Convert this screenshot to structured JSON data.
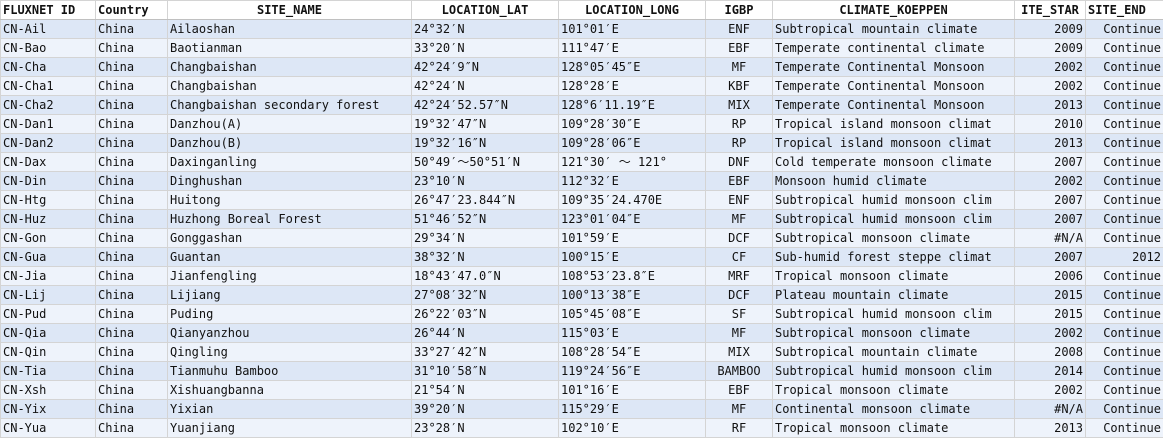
{
  "headers": [
    "FLUXNET ID",
    "Country",
    "SITE_NAME",
    "LOCATION_LAT",
    "LOCATION_LONG",
    "IGBP",
    "CLIMATE_KOEPPEN",
    "ITE_STAR",
    "SITE_END"
  ],
  "rows": [
    [
      "CN-Ail",
      "China",
      "Ailaoshan",
      "24°32′N",
      "101°01′E",
      "ENF",
      "Subtropical mountain climate",
      "2009",
      "Continue"
    ],
    [
      "CN-Bao",
      "China",
      "Baotianman",
      "33°20′N",
      "111°47′E",
      "EBF",
      "Temperate continental climate",
      "2009",
      "Continue"
    ],
    [
      "CN-Cha",
      "China",
      "Changbaishan",
      "42°24′9″N",
      "128°05′45″E",
      "MF",
      "Temperate Continental Monsoon",
      "2002",
      "Continue"
    ],
    [
      "CN-Cha1",
      "China",
      "Changbaishan",
      "42°24′N",
      "128°28′E",
      "KBF",
      "Temperate Continental Monsoon",
      "2002",
      "Continue"
    ],
    [
      "CN-Cha2",
      "China",
      "Changbaishan secondary forest",
      "42°24′52.57″N",
      "128°6′11.19″E",
      "MIX",
      "Temperate Continental Monsoon",
      "2013",
      "Continue"
    ],
    [
      "CN-Dan1",
      "China",
      "Danzhou(A)",
      "19°32′47″N",
      "109°28′30″E",
      "RP",
      "Tropical island monsoon climat",
      "2010",
      "Continue"
    ],
    [
      "CN-Dan2",
      "China",
      "Danzhou(B)",
      "19°32′16″N",
      "109°28′06″E",
      "RP",
      "Tropical island monsoon climat",
      "2013",
      "Continue"
    ],
    [
      "CN-Dax",
      "China",
      "Daxinganling",
      "50°49′～50°51′N",
      "121°30′ ～ 121°",
      "DNF",
      "Cold temperate monsoon climate",
      "2007",
      "Continue"
    ],
    [
      "CN-Din",
      "China",
      "Dinghushan",
      "23°10′N",
      "112°32′E",
      "EBF",
      "Monsoon humid climate",
      "2002",
      "Continue"
    ],
    [
      "CN-Htg",
      "China",
      "Huitong",
      "26°47′23.844″N",
      "109°35′24.470E",
      "ENF",
      "Subtropical humid monsoon clim",
      "2007",
      "Continue"
    ],
    [
      "CN-Huz",
      "China",
      "Huzhong Boreal Forest",
      "51°46′52″N",
      "123°01′04″E",
      "MF",
      "Subtropical humid monsoon clim",
      "2007",
      "Continue"
    ],
    [
      "CN-Gon",
      "China",
      "Gonggashan",
      "29°34′N",
      "101°59′E",
      "DCF",
      "Subtropical monsoon climate",
      "#N/A",
      "Continue"
    ],
    [
      "CN-Gua",
      "China",
      "Guantan",
      "38°32′N",
      "100°15′E",
      "CF",
      "Sub-humid forest steppe climat",
      "2007",
      "2012"
    ],
    [
      "CN-Jia",
      "China",
      "Jianfengling",
      "18°43′47.0″N",
      "108°53′23.8″E",
      "MRF",
      "Tropical monsoon climate",
      "2006",
      "Continue"
    ],
    [
      "CN-Lij",
      "China",
      "Lijiang",
      "27°08′32″N",
      "100°13′38″E",
      "DCF",
      "Plateau mountain climate",
      "2015",
      "Continue"
    ],
    [
      "CN-Pud",
      "China",
      "Puding",
      "26°22′03″N",
      "105°45′08″E",
      "SF",
      "Subtropical humid monsoon clim",
      "2015",
      "Continue"
    ],
    [
      "CN-Qia",
      "China",
      "Qianyanzhou",
      "26°44′N",
      "115°03′E",
      "MF",
      "Subtropical monsoon climate",
      "2002",
      "Continue"
    ],
    [
      "CN-Qin",
      "China",
      "Qingling",
      "33°27′42″N",
      "108°28′54″E",
      "MIX",
      "Subtropical mountain climate",
      "2008",
      "Continue"
    ],
    [
      "CN-Tia",
      "China",
      "Tianmuhu Bamboo",
      "31°10′58″N",
      "119°24′56″E",
      "BAMBOO",
      "Subtropical humid monsoon clim",
      "2014",
      "Continue"
    ],
    [
      "CN-Xsh",
      "China",
      "Xishuangbanna",
      "21°54′N",
      "101°16′E",
      "EBF",
      "Tropical monsoon climate",
      "2002",
      "Continue"
    ],
    [
      "CN-Yix",
      "China",
      "Yixian",
      "39°20′N",
      "115°29′E",
      "MF",
      "Continental monsoon climate",
      "#N/A",
      "Continue"
    ],
    [
      "CN-Yua",
      "China",
      "Yuanjiang",
      "23°28′N",
      "102°10′E",
      "RF",
      "Tropical monsoon climate",
      "2013",
      "Continue"
    ]
  ]
}
